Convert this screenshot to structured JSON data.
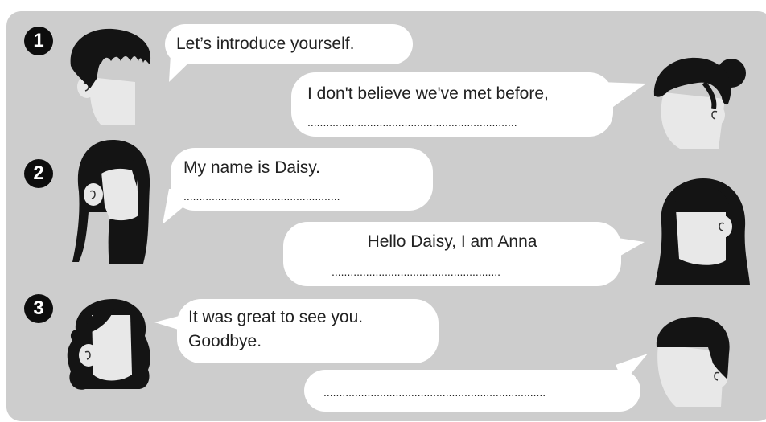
{
  "steps": [
    {
      "number": "1"
    },
    {
      "number": "2"
    },
    {
      "number": "3"
    }
  ],
  "dialogue": {
    "line1": {
      "text": "Let’s introduce yourself."
    },
    "line2": {
      "text": "I don't believe we've met before,",
      "blank": "..................................................................."
    },
    "line3": {
      "text": "My name is Daisy.",
      "blank": ".................................................."
    },
    "line4": {
      "text": "Hello Daisy, I am Anna",
      "blank": "......................................................"
    },
    "line5": {
      "text1": "It was great to see you.",
      "text2": "Goodbye."
    },
    "line6": {
      "blank": "......................................................................."
    }
  },
  "colors": {
    "panel": "#cdcdcd",
    "bubble": "#ffffff",
    "hair": "#141414",
    "skin": "#e8e8e8"
  }
}
